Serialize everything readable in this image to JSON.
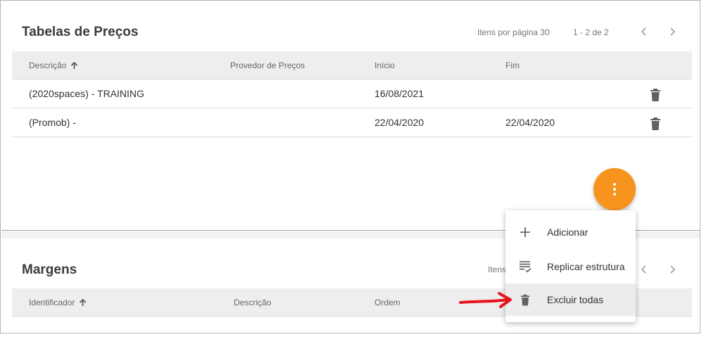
{
  "precos": {
    "title": "Tabelas de Preços",
    "itens_por_pagina_label": "Itens por página",
    "itens_por_pagina_value": "30",
    "range": "1 - 2 de 2",
    "columns": [
      "Descrição",
      "Provedor de Preços",
      "Início",
      "Fim"
    ],
    "rows": [
      {
        "descricao": "(2020spaces) - TRAINING",
        "provedor": "",
        "inicio": "16/08/2021",
        "fim": ""
      },
      {
        "descricao": "(Promob) -",
        "provedor": "",
        "inicio": "22/04/2020",
        "fim": "22/04/2020"
      }
    ]
  },
  "margens": {
    "title": "Margens",
    "itens_partial": "Itens",
    "columns": [
      "Identificador",
      "Descrição",
      "Ordem"
    ]
  },
  "fab_menu": {
    "items": [
      {
        "label": "Adicionar",
        "icon": "plus-icon"
      },
      {
        "label": "Replicar estrutura",
        "icon": "playlist-check-icon"
      },
      {
        "label": "Excluir todas",
        "icon": "trash-icon"
      }
    ]
  },
  "colors": {
    "fab": "#f7941d",
    "annotation_arrow": "#e8141c"
  }
}
